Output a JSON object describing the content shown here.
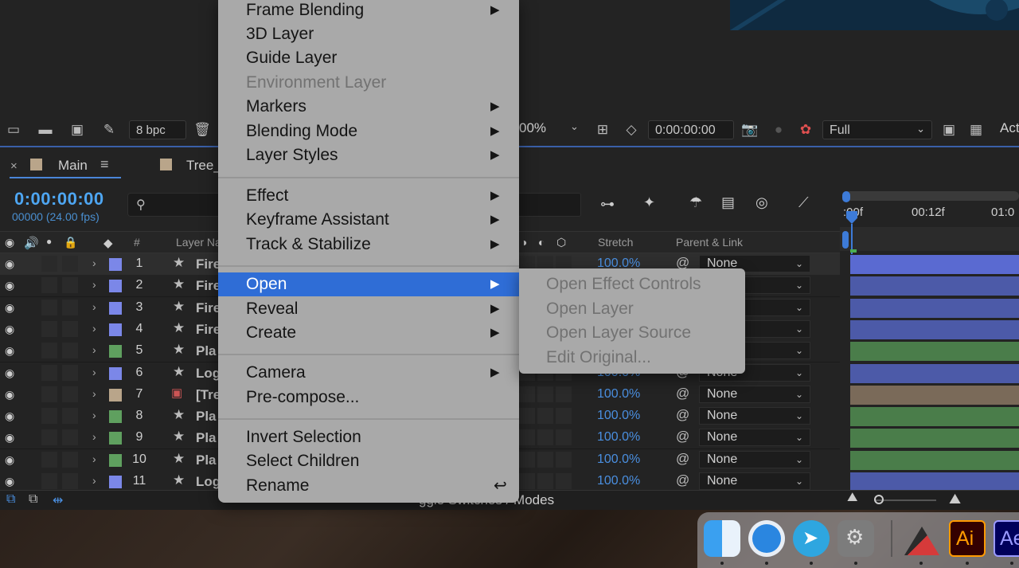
{
  "viewer_toolbar": {
    "bpc_label": "8 bpc",
    "zoom_value": "00%",
    "current_time": "0:00:00:00",
    "resolution": "Full",
    "view_label": "Act"
  },
  "timeline": {
    "tabs": [
      {
        "label": "Main"
      },
      {
        "label": "Tree_"
      }
    ],
    "timecode": "0:00:00:00",
    "fps_label": "00000 (24.00 fps)",
    "columns": {
      "hash": "#",
      "layer_name": "Layer Na",
      "stretch": "Stretch",
      "parent_link": "Parent & Link"
    },
    "ruler": {
      "t0": ":00f",
      "t1": "00:12f",
      "t2": "01:0"
    },
    "bottom_label": "ggle Switches / Modes",
    "layers": [
      {
        "num": "1",
        "name": "Fire",
        "stretch": "100.0%",
        "parent": "None",
        "color": "#7b87e8",
        "bar": "#5a6ad1"
      },
      {
        "num": "2",
        "name": "Fire",
        "stretch": "",
        "parent": "",
        "color": "#7b87e8",
        "bar": "#4c5aa8"
      },
      {
        "num": "3",
        "name": "Fire",
        "stretch": "",
        "parent": "",
        "color": "#7b87e8",
        "bar": "#4c5aa8"
      },
      {
        "num": "4",
        "name": "Fire",
        "stretch": "",
        "parent": "",
        "color": "#7b87e8",
        "bar": "#4c5aa8"
      },
      {
        "num": "5",
        "name": "Pla",
        "stretch": "",
        "parent": "",
        "color": "#5fa05f",
        "bar": "#4a7d4a"
      },
      {
        "num": "6",
        "name": "Log",
        "stretch": "100.0%",
        "parent": "None",
        "color": "#7b87e8",
        "bar": "#4c5aa8"
      },
      {
        "num": "7",
        "name": "[Tre",
        "stretch": "100.0%",
        "parent": "None",
        "color": "#b9a58a",
        "bar": "#7a6a59"
      },
      {
        "num": "8",
        "name": "Pla",
        "stretch": "100.0%",
        "parent": "None",
        "color": "#5fa05f",
        "bar": "#4a7d4a"
      },
      {
        "num": "9",
        "name": "Pla",
        "stretch": "100.0%",
        "parent": "None",
        "color": "#5fa05f",
        "bar": "#4a7d4a"
      },
      {
        "num": "10",
        "name": "Pla",
        "stretch": "100.0%",
        "parent": "None",
        "color": "#5fa05f",
        "bar": "#4a7d4a"
      },
      {
        "num": "11",
        "name": "Log",
        "stretch": "100.0%",
        "parent": "None",
        "color": "#7b87e8",
        "bar": "#4c5aa8"
      }
    ]
  },
  "context_menu": {
    "items": [
      {
        "label": "Frame Blending",
        "submenu": true,
        "disabled": false
      },
      {
        "label": "3D Layer",
        "submenu": false,
        "disabled": false
      },
      {
        "label": "Guide Layer",
        "submenu": false,
        "disabled": false
      },
      {
        "label": "Environment Layer",
        "submenu": false,
        "disabled": true
      },
      {
        "label": "Markers",
        "submenu": true,
        "disabled": false
      },
      {
        "label": "Blending Mode",
        "submenu": true,
        "disabled": false
      },
      {
        "label": "Layer Styles",
        "submenu": true,
        "disabled": false
      },
      {
        "label": "Effect",
        "submenu": true,
        "disabled": false
      },
      {
        "label": "Keyframe Assistant",
        "submenu": true,
        "disabled": false
      },
      {
        "label": "Track & Stabilize",
        "submenu": true,
        "disabled": false
      },
      {
        "label": "Open",
        "submenu": true,
        "disabled": false,
        "selected": true
      },
      {
        "label": "Reveal",
        "submenu": true,
        "disabled": false
      },
      {
        "label": "Create",
        "submenu": true,
        "disabled": false
      },
      {
        "label": "Camera",
        "submenu": true,
        "disabled": false
      },
      {
        "label": "Pre-compose...",
        "submenu": false,
        "disabled": false
      },
      {
        "label": "Invert Selection",
        "submenu": false,
        "disabled": false
      },
      {
        "label": "Select Children",
        "submenu": false,
        "disabled": false
      },
      {
        "label": "Rename",
        "submenu": false,
        "disabled": false,
        "shortcut": "↩"
      }
    ]
  },
  "open_submenu": {
    "items": [
      {
        "label": "Open Effect Controls",
        "disabled": true
      },
      {
        "label": "Open Layer",
        "disabled": true
      },
      {
        "label": "Open Layer Source",
        "disabled": true
      },
      {
        "label": "Edit Original...",
        "disabled": true
      }
    ]
  },
  "dock": {
    "apps": [
      {
        "icon": "finder-icon"
      },
      {
        "icon": "safari-icon"
      },
      {
        "icon": "telegram-icon"
      },
      {
        "icon": "system-preferences-icon"
      },
      {
        "icon": "affinity-icon"
      },
      {
        "icon": "illustrator-icon",
        "label": "Ai"
      },
      {
        "icon": "after-effects-icon",
        "label": "Ae"
      }
    ]
  },
  "colors": {
    "accent": "#2f6dd6",
    "timecode_blue": "#4ea6f2",
    "menu_bg": "#a9a9a9"
  }
}
